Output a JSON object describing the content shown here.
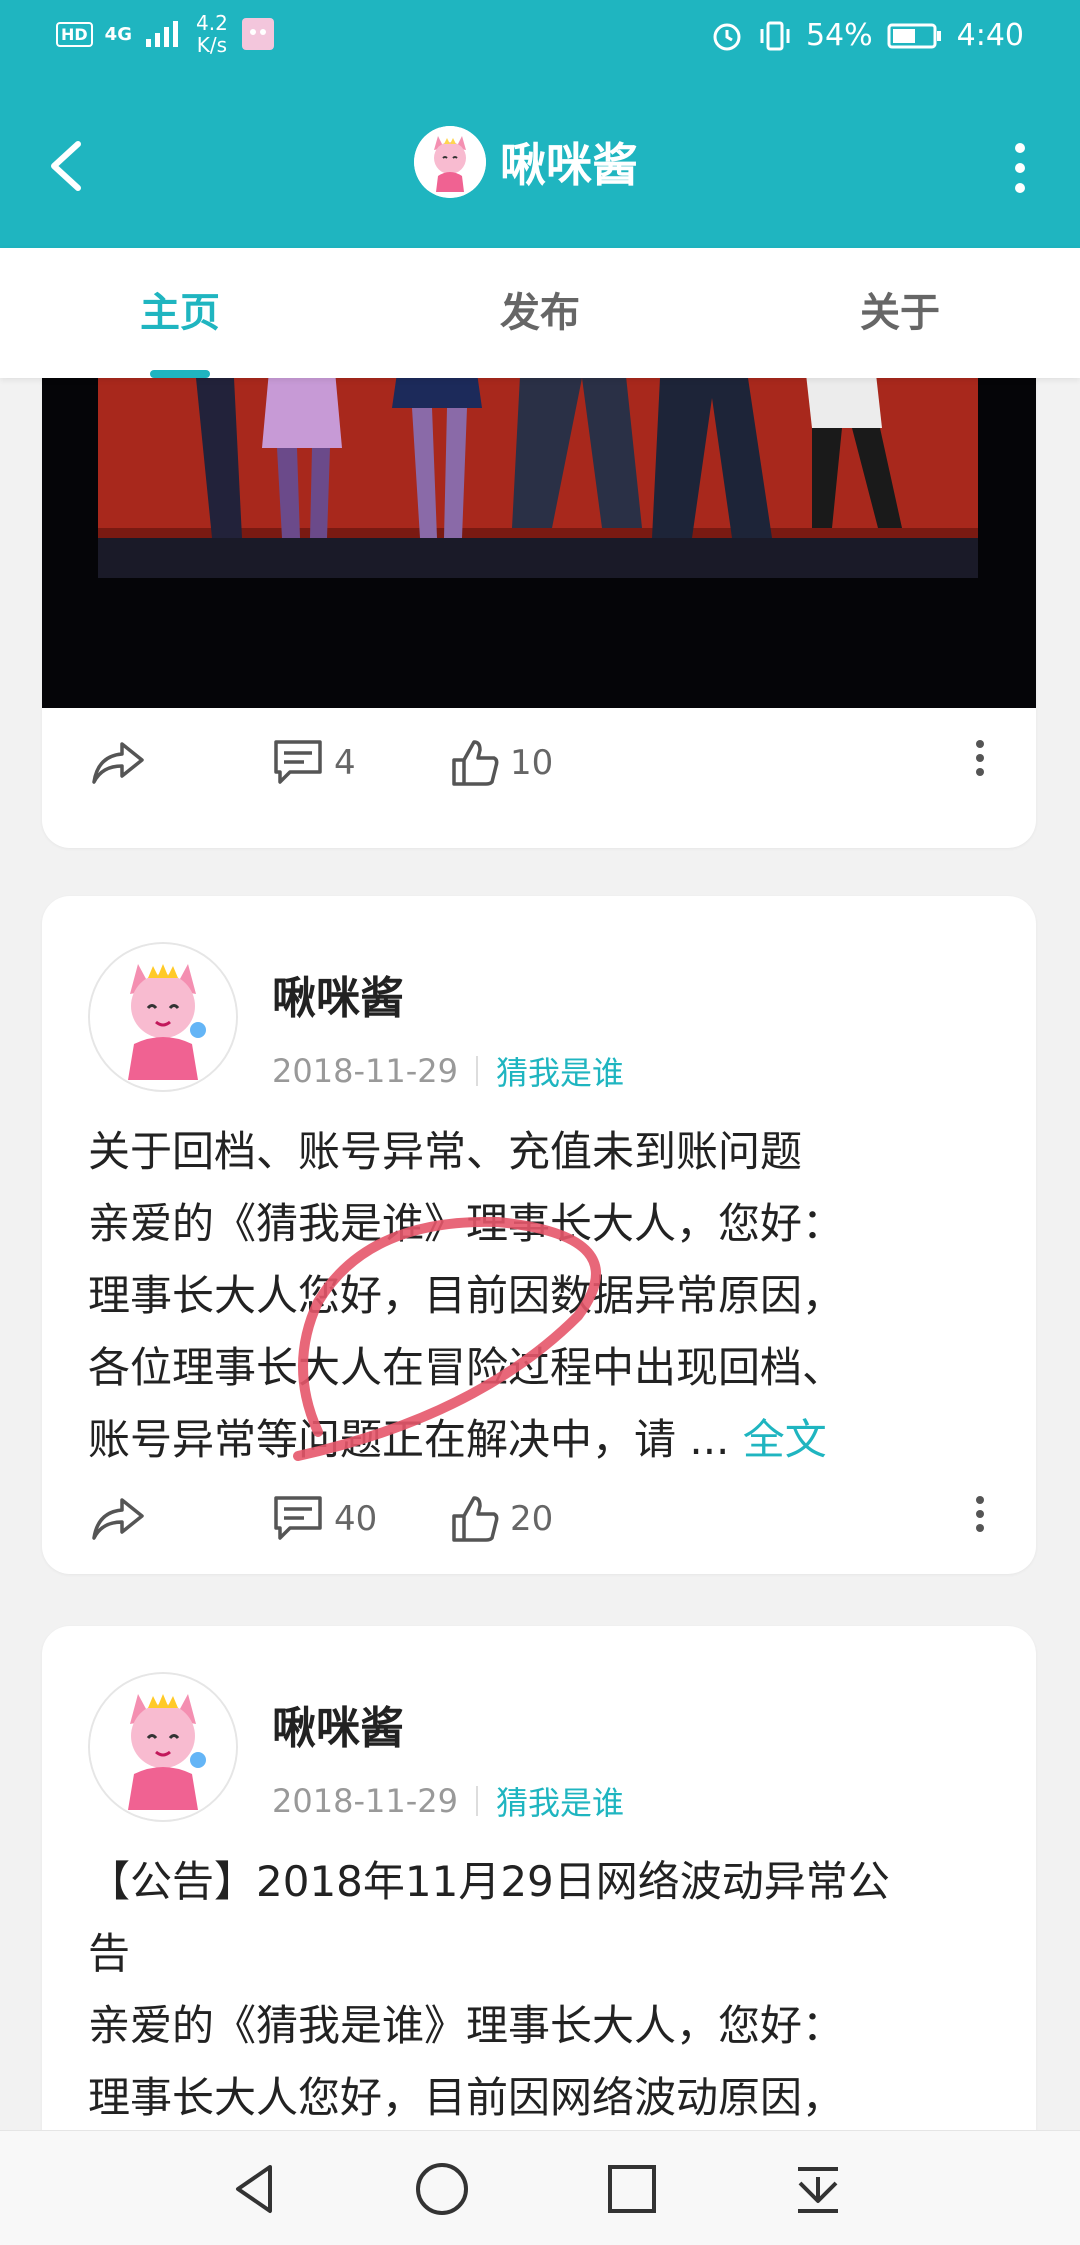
{
  "status_bar": {
    "network_badge": "HD",
    "network_type": "4G",
    "speed_value": "4.2",
    "speed_unit": "K/s",
    "battery": "54%",
    "time": "4:40"
  },
  "app_bar": {
    "title": "啾咪酱",
    "back_icon": "back-arrow-icon",
    "more_icon": "more-vertical-icon"
  },
  "tabs": [
    {
      "label": "主页",
      "active": true
    },
    {
      "label": "发布",
      "active": false
    },
    {
      "label": "关于",
      "active": false
    }
  ],
  "posts": [
    {
      "comments": "4",
      "likes": "10"
    },
    {
      "author": "啾咪酱",
      "date": "2018-11-29",
      "tag": "猜我是谁",
      "lines": [
        "关于回档、账号异常、充值未到账问题",
        "亲爱的《猜我是谁》理事长大人，您好：",
        "理事长大人您好，目前因数据异常原因，",
        "各位理事长大人在冒险过程中出现回档、",
        "账号异常等问题正在解决中，请 ... "
      ],
      "more_link": "全文",
      "comments": "40",
      "likes": "20"
    },
    {
      "author": "啾咪酱",
      "date": "2018-11-29",
      "tag": "猜我是谁",
      "lines": [
        "【公告】2018年11月29日网络波动异常公",
        "告",
        "亲爱的《猜我是谁》理事长大人，您好：",
        "理事长大人您好，目前因网络波动原因，"
      ]
    }
  ],
  "colors": {
    "accent": "#1fb5c0",
    "annotation": "#e5566a"
  }
}
